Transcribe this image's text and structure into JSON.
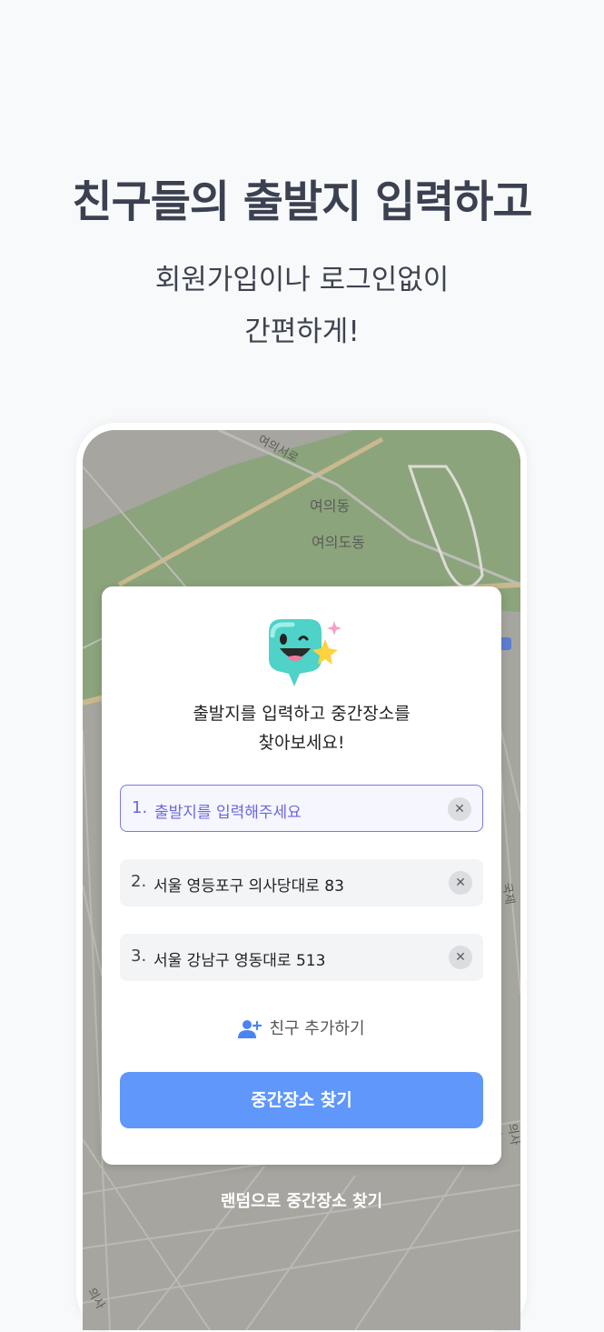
{
  "header": {
    "headline": "친구들의 출발지 입력하고",
    "subline_1": "회원가입이나 로그인없이",
    "subline_2": "간편하게!"
  },
  "map": {
    "labels": [
      "여의서로",
      "여의동",
      "여의도동",
      "국제",
      "의사당",
      "의사"
    ]
  },
  "card": {
    "title_line_1": "출발지를 입력하고 중간장소를",
    "title_line_2": "찾아보세요!",
    "fields": [
      {
        "number": "1.",
        "text": "출발지를 입력해주세요",
        "state": "active-placeholder"
      },
      {
        "number": "2.",
        "text": "서울 영등포구 의사당대로 83",
        "state": "filled"
      },
      {
        "number": "3.",
        "text": "서울 강남구 영동대로 513",
        "state": "filled"
      }
    ],
    "clear_symbol": "✕",
    "add_friend_label": "친구 추가하기",
    "primary_button_label": "중간장소 찾기"
  },
  "random_link_label": "랜덤으로 중간장소 찾기",
  "colors": {
    "primary": "#5f97fa",
    "active_border": "#7b77e6",
    "map_green": "#8ba47c",
    "map_gray": "#a6a59f"
  }
}
